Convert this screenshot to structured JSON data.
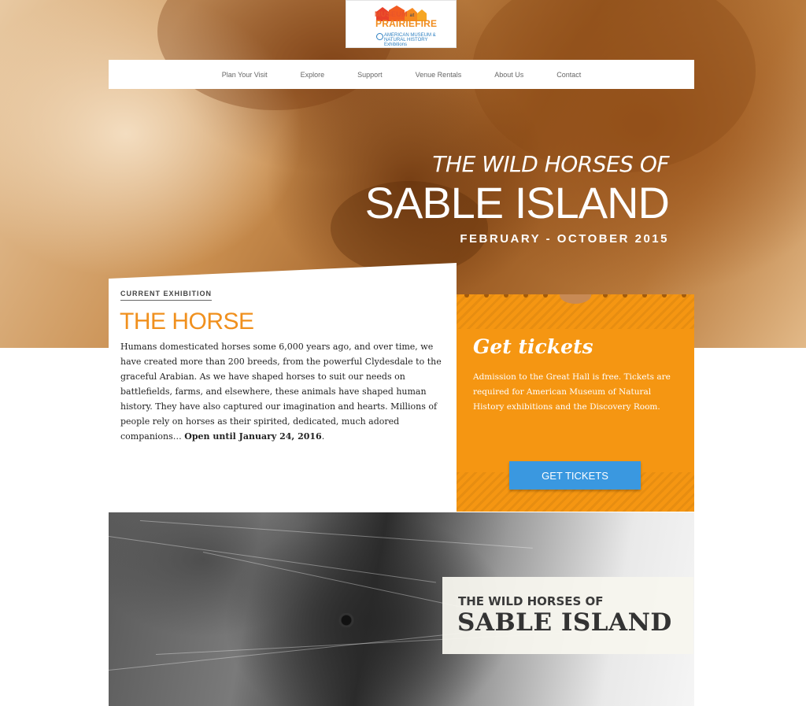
{
  "logo": {
    "line1": "MUSEUM",
    "line1_at": "at",
    "line2": "PRAIRIEFIRE",
    "partner": "AMERICAN MUSEUM & NATURAL HISTORY",
    "partner_sub": "Exhibitions"
  },
  "nav": {
    "items": [
      "Plan Your Visit",
      "Explore",
      "Support",
      "Venue Rentals",
      "About Us",
      "Contact"
    ]
  },
  "hero": {
    "kicker": "THE WILD HORSES OF",
    "title": "SABLE ISLAND",
    "dates": "FEBRUARY - OCTOBER 2015"
  },
  "exhibition": {
    "label": "CURRENT EXHIBITION",
    "title": "THE HORSE",
    "body": "Humans domesticated horses some 6,000 years ago, and over time, we have created more than 200 breeds, from the powerful Clydesdale to the graceful Arabian. As we have shaped horses to suit our needs on battlefields, farms, and elsewhere, these animals have shaped human history. They have also captured our imagination and hearts. Millions of people rely on horses as their spirited, dedicated, much adored companions…",
    "closing": "Open until January 24, 2016",
    "end_punct": "."
  },
  "tickets": {
    "title": "Get tickets",
    "description": "Admission to the Great Hall is free. Tickets are required for American Museum of Natural History exhibitions and the Discovery Room.",
    "button": "GET TICKETS"
  },
  "banner": {
    "kicker": "THE WILD HORSES OF",
    "title": "SABLE ISLAND"
  },
  "colors": {
    "accent_orange": "#f0901e",
    "tickets_bg": "#f59612",
    "button_blue": "#3a98e0"
  }
}
